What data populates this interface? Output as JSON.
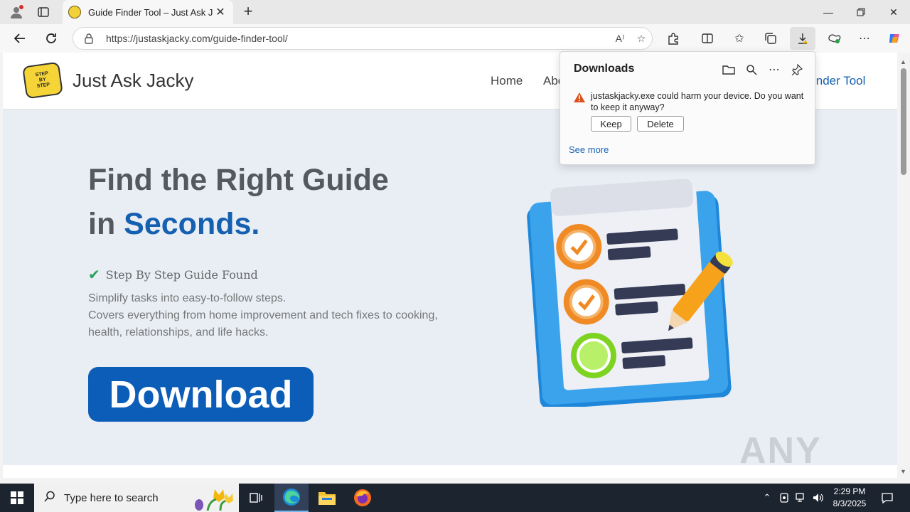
{
  "browser": {
    "tab_title": "Guide Finder Tool – Just Ask Jacky",
    "url": "https://justaskjacky.com/guide-finder-tool/",
    "new_tab_symbol": "+"
  },
  "downloads_panel": {
    "title": "Downloads",
    "warning": "justaskjacky.exe could harm your device. Do you want to keep it anyway?",
    "keep_label": "Keep",
    "delete_label": "Delete",
    "see_more": "See more"
  },
  "site": {
    "logo_text": [
      "STEP",
      "BY",
      "STEP"
    ],
    "title": "Just Ask Jacky",
    "nav": {
      "home": "Home",
      "about_partial": "Abo",
      "finder_partial": "inder Tool"
    }
  },
  "hero": {
    "line1": "Find the Right Guide",
    "line2_prefix": "in ",
    "line2_highlight": "Seconds",
    "line2_suffix": ".",
    "check_text": "Step By Step Guide Found",
    "desc1": "Simplify tasks into easy-to-follow steps.",
    "desc2": "Covers everything from home improvement and tech fixes to cooking, health, relationships, and life hacks.",
    "download_button": "Download"
  },
  "watermark": "ANY RUN",
  "taskbar": {
    "search_placeholder": "Type here to search",
    "time": "2:29 PM",
    "date": "8/3/2025"
  },
  "colors": {
    "accent_blue": "#1560b0",
    "download_button": "#0c5db8",
    "check_green": "#29a35a",
    "warning_orange": "#d9531e"
  }
}
